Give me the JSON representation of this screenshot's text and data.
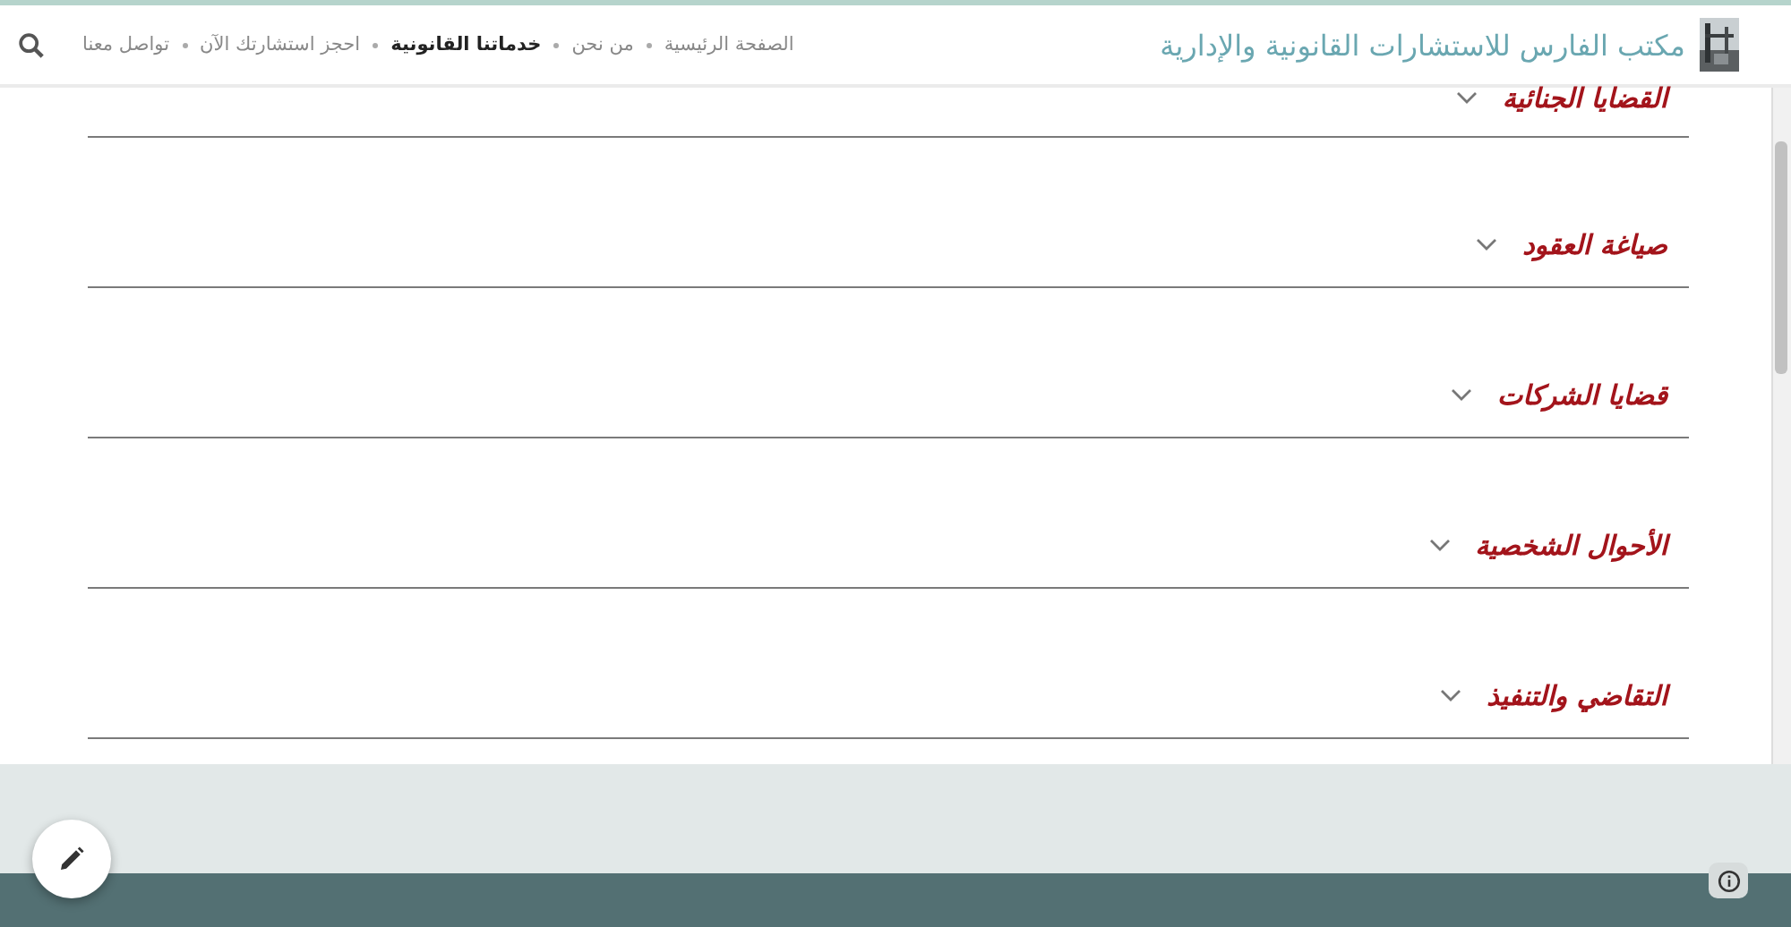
{
  "header": {
    "title": "مكتب الفارس للاستشارات القانونية والإدارية",
    "nav": [
      {
        "label": "الصفحة الرئيسية",
        "selected": false
      },
      {
        "label": "من نحن",
        "selected": false
      },
      {
        "label": "خدماتنا القانونية",
        "selected": true
      },
      {
        "label": "احجز استشارتك الآن",
        "selected": false
      },
      {
        "label": "تواصل معنا",
        "selected": false
      }
    ]
  },
  "accordion": [
    {
      "title": "القضايا الجنائية",
      "expanded": false
    },
    {
      "title": "صياغة العقود",
      "expanded": false
    },
    {
      "title": "قضايا الشركات",
      "expanded": false
    },
    {
      "title": "الأحوال الشخصية",
      "expanded": false
    },
    {
      "title": "التقاضي والتنفيذ",
      "expanded": false
    }
  ]
}
